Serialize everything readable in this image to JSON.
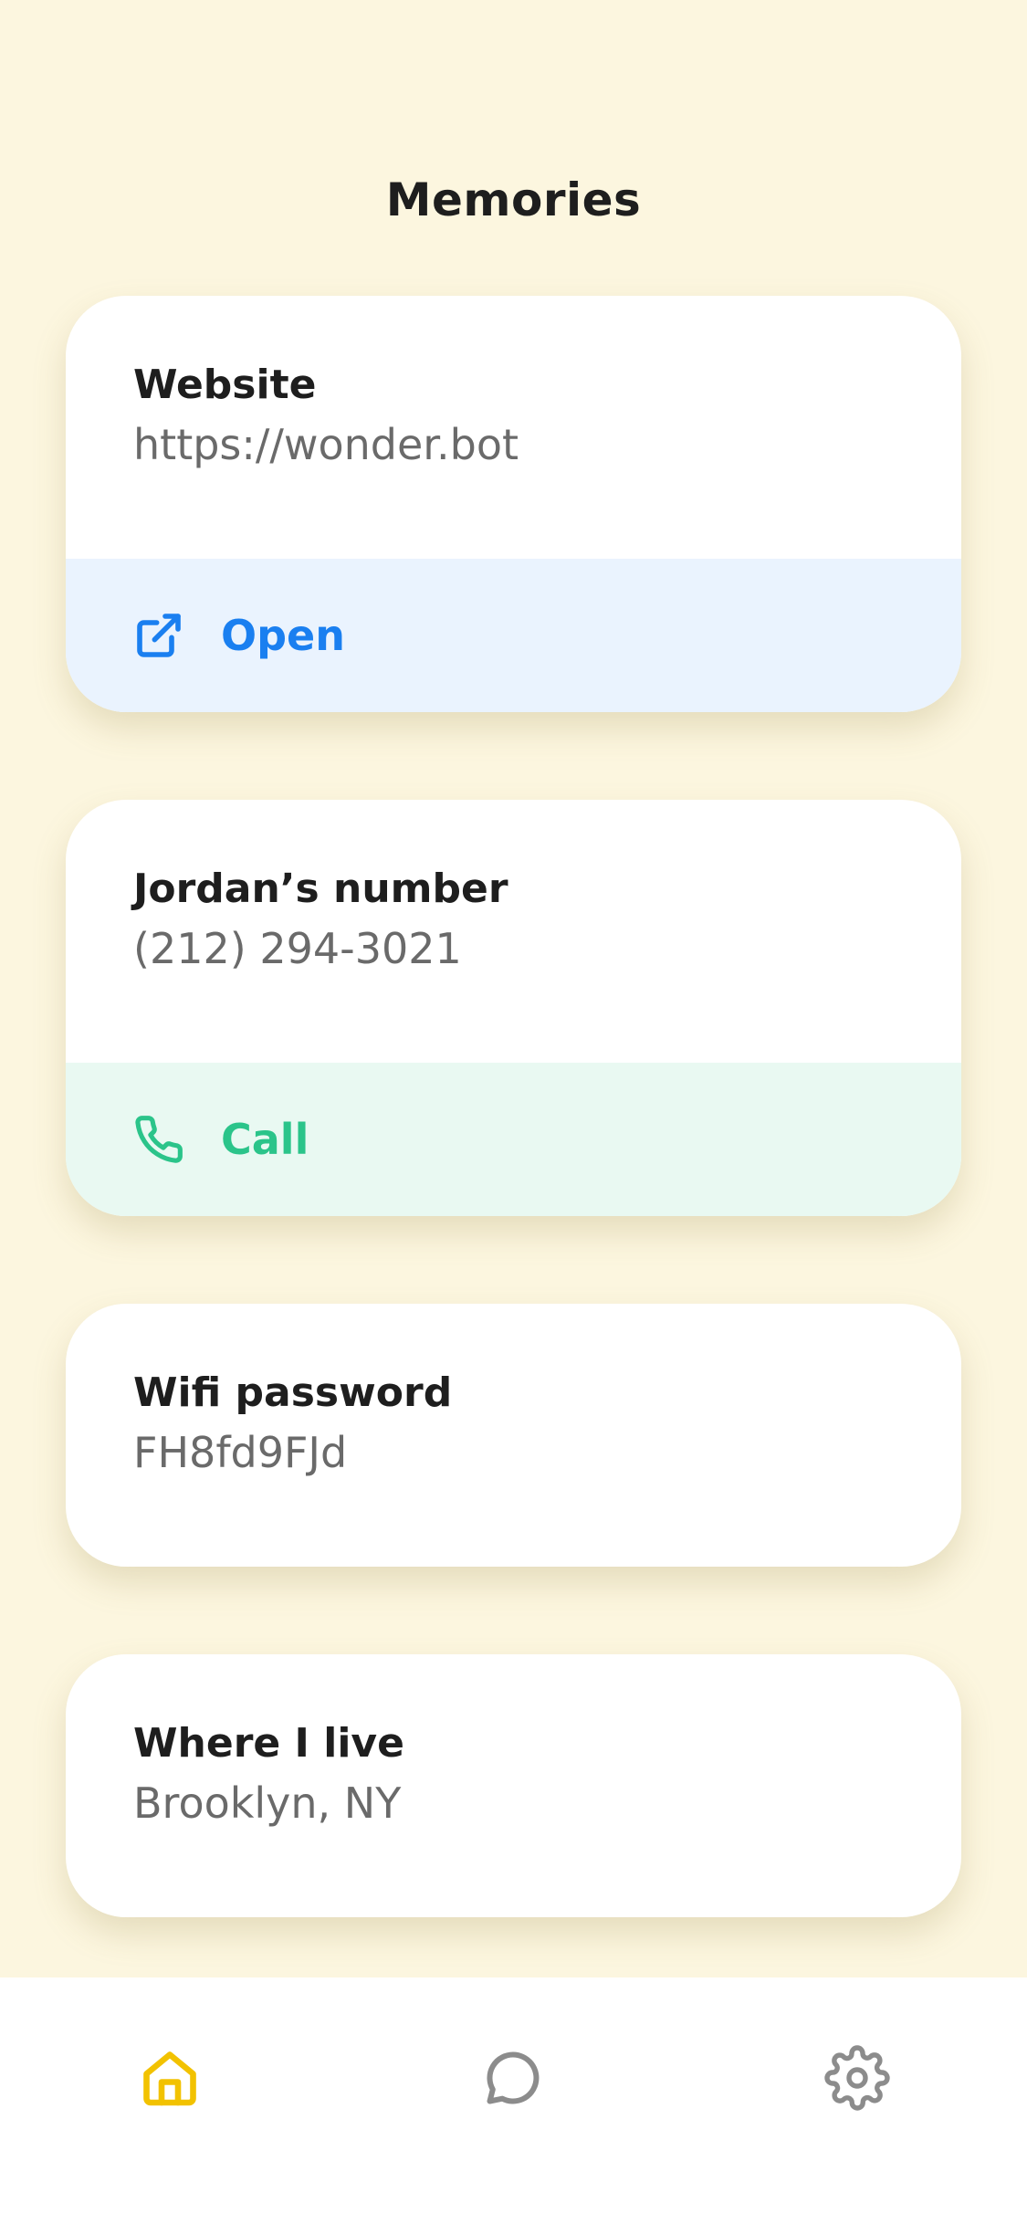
{
  "header": {
    "title": "Memories"
  },
  "memories": [
    {
      "label": "Website",
      "value": "https://wonder.bot",
      "action": {
        "label": "Open",
        "icon": "external-link-icon",
        "color": "#1A7FF0",
        "background": "#EAF3FE"
      }
    },
    {
      "label": "Jordan’s number",
      "value": "(212) 294-3021",
      "action": {
        "label": "Call",
        "icon": "phone-icon",
        "color": "#2BC48A",
        "background": "#E9F9F2"
      }
    },
    {
      "label": "Wifi password",
      "value": "FH8fd9FJd"
    },
    {
      "label": "Where I live",
      "value": "Brooklyn, NY"
    }
  ],
  "tabbar": {
    "tabs": [
      {
        "icon": "home-icon",
        "active": true,
        "color": "#F2C200"
      },
      {
        "icon": "chat-bubble-icon",
        "active": false,
        "color": "#8C8C8C"
      },
      {
        "icon": "gear-icon",
        "active": false,
        "color": "#8C8C8C"
      }
    ]
  },
  "colors": {
    "background": "#FCF6DF",
    "card": "#FFFFFF",
    "text_primary": "#1E1E1E",
    "text_secondary": "#6A6A6A"
  }
}
